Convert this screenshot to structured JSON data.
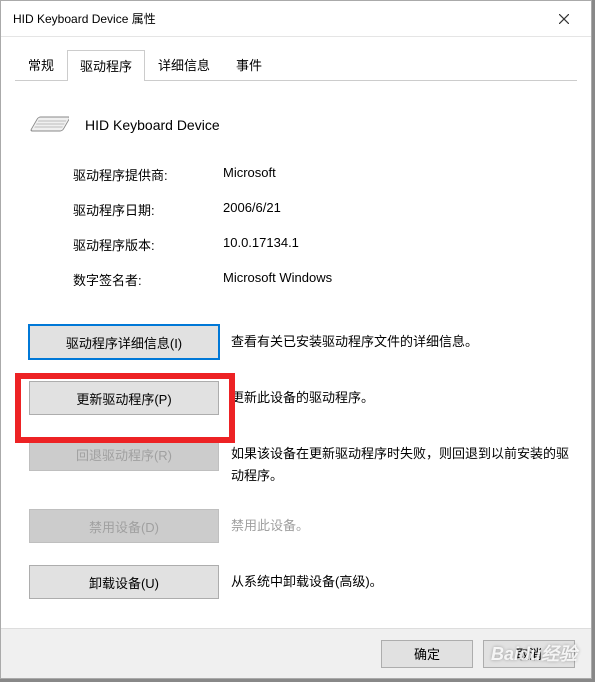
{
  "window": {
    "title": "HID Keyboard Device 属性"
  },
  "tabs": {
    "general": "常规",
    "driver": "驱动程序",
    "details": "详细信息",
    "events": "事件"
  },
  "device": {
    "name": "HID Keyboard Device"
  },
  "info": {
    "provider_label": "驱动程序提供商:",
    "provider_value": "Microsoft",
    "date_label": "驱动程序日期:",
    "date_value": "2006/6/21",
    "version_label": "驱动程序版本:",
    "version_value": "10.0.17134.1",
    "signer_label": "数字签名者:",
    "signer_value": "Microsoft Windows"
  },
  "actions": {
    "details_btn": "驱动程序详细信息(I)",
    "details_desc": "查看有关已安装驱动程序文件的详细信息。",
    "update_btn": "更新驱动程序(P)",
    "update_desc": "更新此设备的驱动程序。",
    "rollback_btn": "回退驱动程序(R)",
    "rollback_desc": "如果该设备在更新驱动程序时失败，则回退到以前安装的驱动程序。",
    "disable_btn": "禁用设备(D)",
    "disable_desc": "禁用此设备。",
    "uninstall_btn": "卸载设备(U)",
    "uninstall_desc": "从系统中卸载设备(高级)。"
  },
  "footer": {
    "ok": "确定",
    "cancel": "取消"
  },
  "watermark": "Baidu经验"
}
